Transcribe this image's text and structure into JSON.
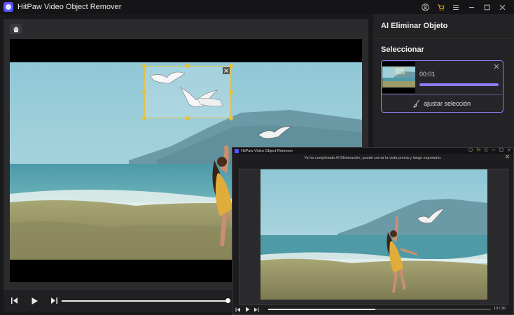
{
  "app": {
    "title": "HitPaw Video Object Remover"
  },
  "titlebar_icons": [
    "user-icon",
    "cart-icon",
    "menu-icon",
    "minimize-icon",
    "maximize-icon",
    "close-icon"
  ],
  "player": {
    "progress": 1.0
  },
  "side_panel": {
    "title": "AI Eliminar Objeto",
    "section_label": "Seleccionar",
    "selection": {
      "time": "00:01",
      "adjust_label": "ajustar selección"
    }
  },
  "preview": {
    "title": "HitPaw Video Object Remover",
    "message": "Ya ha completado AI Eliminación, puede cerrar la vista previa y luego exportarlo.",
    "progress": 0.48,
    "counter": "13 / 26"
  },
  "colors": {
    "accent": "#8e7cf0",
    "selection_handle": "#e8c13a",
    "cart": "#f0a818"
  }
}
